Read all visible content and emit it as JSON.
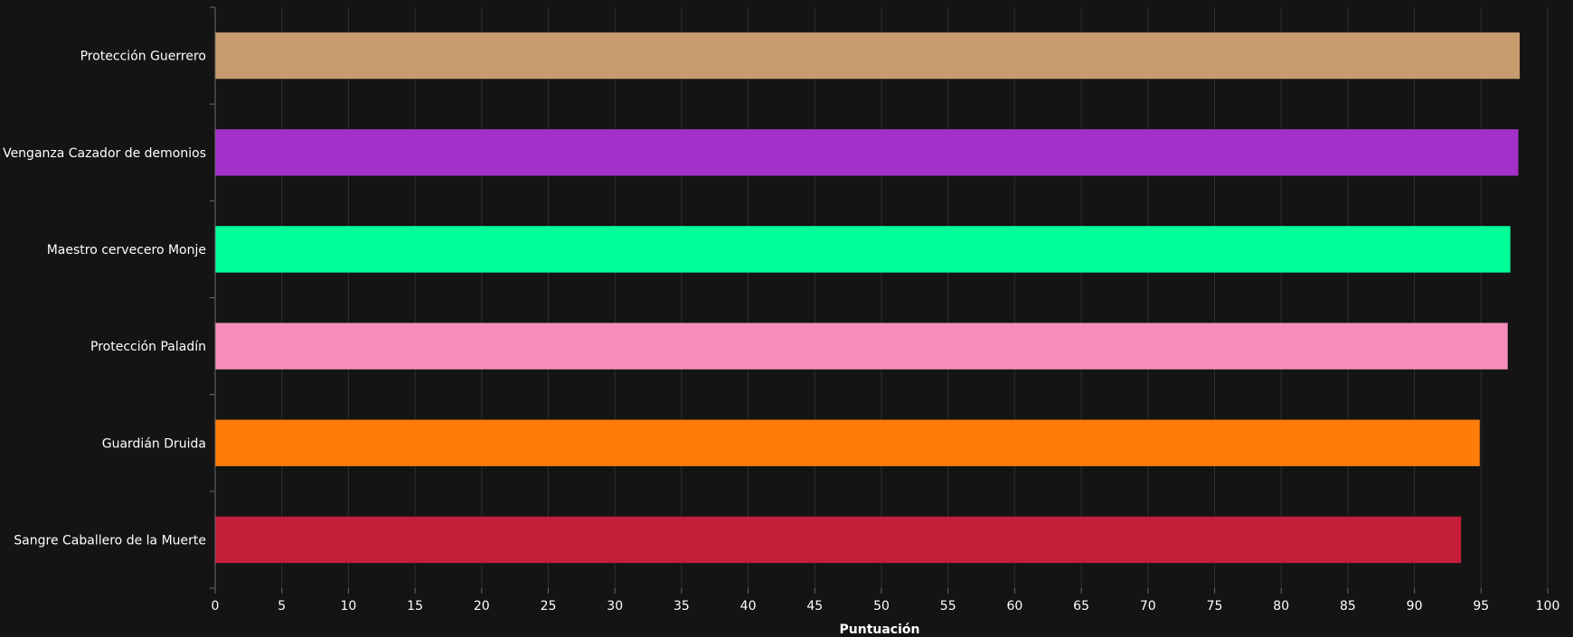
{
  "chart_data": {
    "type": "bar",
    "orientation": "horizontal",
    "title": "",
    "xlabel": "Puntuación",
    "ylabel": "",
    "xlim": [
      0,
      100
    ],
    "x_ticks": [
      0,
      5,
      10,
      15,
      20,
      25,
      30,
      35,
      40,
      45,
      50,
      55,
      60,
      65,
      70,
      75,
      80,
      85,
      90,
      95,
      100
    ],
    "grid": "vertical",
    "categories": [
      "Protección Guerrero",
      "Venganza Cazador de demonios",
      "Maestro cervecero Monje",
      "Protección Paladín",
      "Guardián Druida",
      "Sangre Caballero de la Muerte"
    ],
    "values": [
      97.9,
      97.8,
      97.2,
      97.0,
      94.9,
      93.5
    ],
    "colors": [
      "#C69B6D",
      "#A330C9",
      "#00FF98",
      "#F58CBA",
      "#FF7C0A",
      "#C41E3A"
    ]
  }
}
